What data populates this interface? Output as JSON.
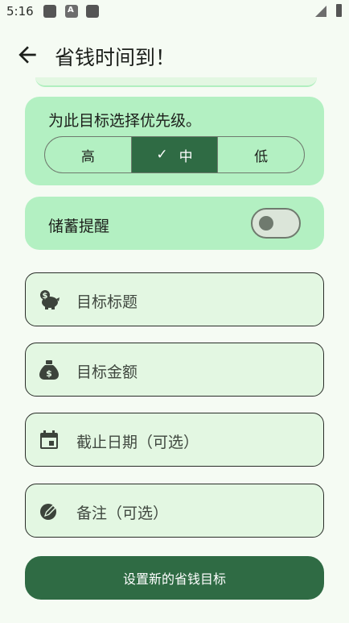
{
  "status_bar": {
    "time": "5:16",
    "notification_letter": "A"
  },
  "app_bar": {
    "title": "省钱时间到！"
  },
  "priority": {
    "label": "为此目标选择优先级。",
    "options": [
      "高",
      "中",
      "低"
    ],
    "selected": "中",
    "check_glyph": "✓"
  },
  "reminder": {
    "label": "储蓄提醒",
    "enabled": false
  },
  "fields": {
    "goal_title": "目标标题",
    "goal_amount": "目标金额",
    "deadline": "截止日期（可选）",
    "notes": "备注（可选）"
  },
  "icons": {
    "back": "arrow-left-icon",
    "goal_title": "piggy-bank-icon",
    "goal_amount": "money-bag-icon",
    "deadline": "calendar-icon",
    "notes": "pencil-icon"
  },
  "submit": {
    "label": "设置新的省钱目标"
  },
  "colors": {
    "primary": "#2f6b44",
    "card": "#b3f0c2",
    "field_bg": "#e3f7e2",
    "background": "#f5fbf3"
  }
}
